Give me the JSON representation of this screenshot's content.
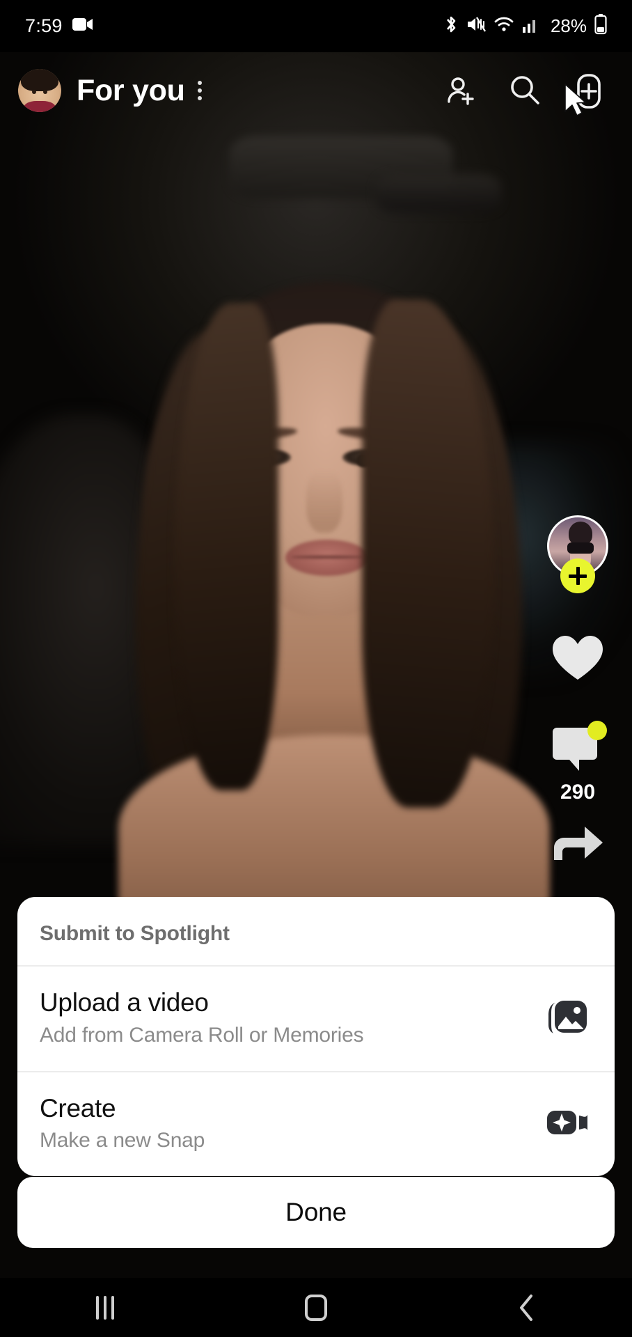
{
  "status_bar": {
    "time": "7:59",
    "battery_percent": "28%",
    "icons": [
      "video-recording-icon",
      "bluetooth-icon",
      "mute-icon",
      "wifi-icon",
      "cellular-signal-icon",
      "battery-icon"
    ]
  },
  "top_bar": {
    "title": "For you",
    "avatar_name": "bitmoji-avatar",
    "overflow_icon": "three-dots-vertical-icon",
    "actions": [
      {
        "name": "add-friend-icon"
      },
      {
        "name": "search-icon"
      },
      {
        "name": "upload-plus-icon"
      }
    ],
    "cursor": "mouse-pointer"
  },
  "video": {
    "creator_avatar": "creator-profile-avatar",
    "follow_label": "+",
    "like_icon": "heart-icon",
    "comment_icon": "comment-bubble-icon",
    "comment_count": "290",
    "share_icon": "share-arrow-icon",
    "comment_badge_color": "#e2ec21",
    "follow_button_color": "#e8f52e"
  },
  "sheet": {
    "title": "Submit to Spotlight",
    "options": [
      {
        "title": "Upload a video",
        "subtitle": "Add from Camera Roll or Memories",
        "icon": "gallery-photo-icon"
      },
      {
        "title": "Create",
        "subtitle": "Make a new Snap",
        "icon": "camera-sparkle-icon"
      }
    ],
    "done_label": "Done"
  },
  "nav_bar": {
    "recents": "recents-icon",
    "home": "home-icon",
    "back": "back-icon"
  }
}
